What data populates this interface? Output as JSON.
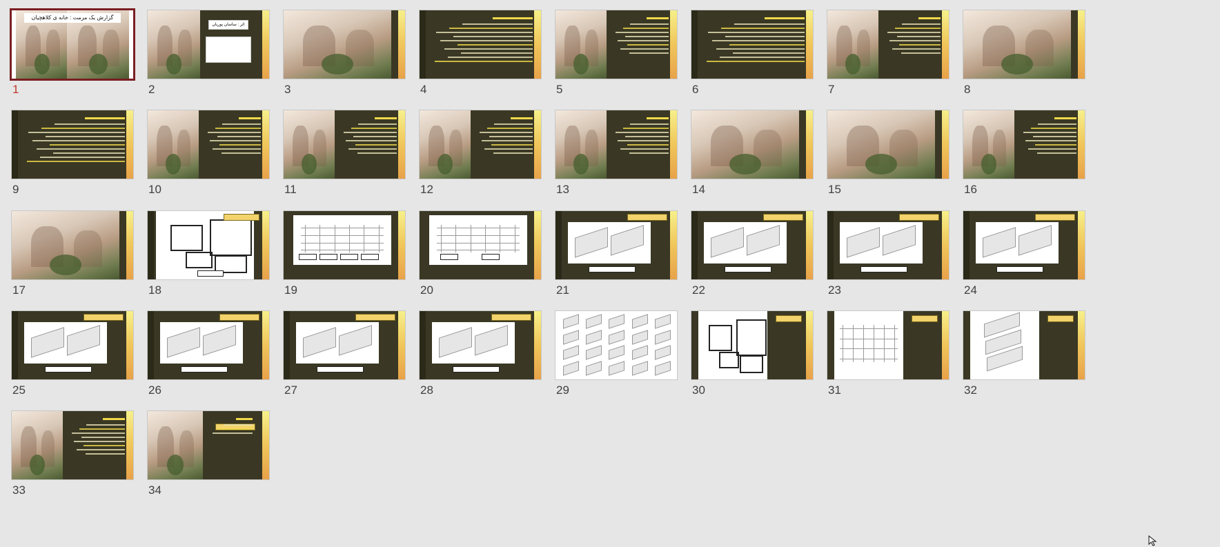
{
  "slides": [
    {
      "number": "1",
      "type": "cover",
      "title": "گزارش یک مرمت : خانه ی کلاهچیان",
      "selected": true
    },
    {
      "number": "2",
      "type": "photo-title",
      "title": "اثر : ساسان پوریان"
    },
    {
      "number": "3",
      "type": "photo-full"
    },
    {
      "number": "4",
      "type": "text"
    },
    {
      "number": "5",
      "type": "photo-text"
    },
    {
      "number": "6",
      "type": "text"
    },
    {
      "number": "7",
      "type": "photo-text"
    },
    {
      "number": "8",
      "type": "photo-full"
    },
    {
      "number": "9",
      "type": "text"
    },
    {
      "number": "10",
      "type": "photo-text"
    },
    {
      "number": "11",
      "type": "photo-text"
    },
    {
      "number": "12",
      "type": "photo-text"
    },
    {
      "number": "13",
      "type": "photo-text"
    },
    {
      "number": "14",
      "type": "photo-full"
    },
    {
      "number": "15",
      "type": "photo-full"
    },
    {
      "number": "16",
      "type": "photo-text"
    },
    {
      "number": "17",
      "type": "photo-full"
    },
    {
      "number": "18",
      "type": "plan"
    },
    {
      "number": "19",
      "type": "elevation"
    },
    {
      "number": "20",
      "type": "section"
    },
    {
      "number": "21",
      "type": "axon"
    },
    {
      "number": "22",
      "type": "axon"
    },
    {
      "number": "23",
      "type": "axon"
    },
    {
      "number": "24",
      "type": "axon"
    },
    {
      "number": "25",
      "type": "axon"
    },
    {
      "number": "26",
      "type": "axon"
    },
    {
      "number": "27",
      "type": "axon"
    },
    {
      "number": "28",
      "type": "axon"
    },
    {
      "number": "29",
      "type": "grid"
    },
    {
      "number": "30",
      "type": "plan-small"
    },
    {
      "number": "31",
      "type": "elevation-small"
    },
    {
      "number": "32",
      "type": "exploded"
    },
    {
      "number": "33",
      "type": "photo-text"
    },
    {
      "number": "34",
      "type": "photo-end"
    }
  ],
  "accent_colors": {
    "selected_border": "#7a1e22",
    "selected_number": "#c0392b",
    "slide_dark": "#3a3824",
    "strip_yellow": "#f0c65a"
  },
  "icons": {
    "cursor": "mouse-pointer-icon"
  }
}
